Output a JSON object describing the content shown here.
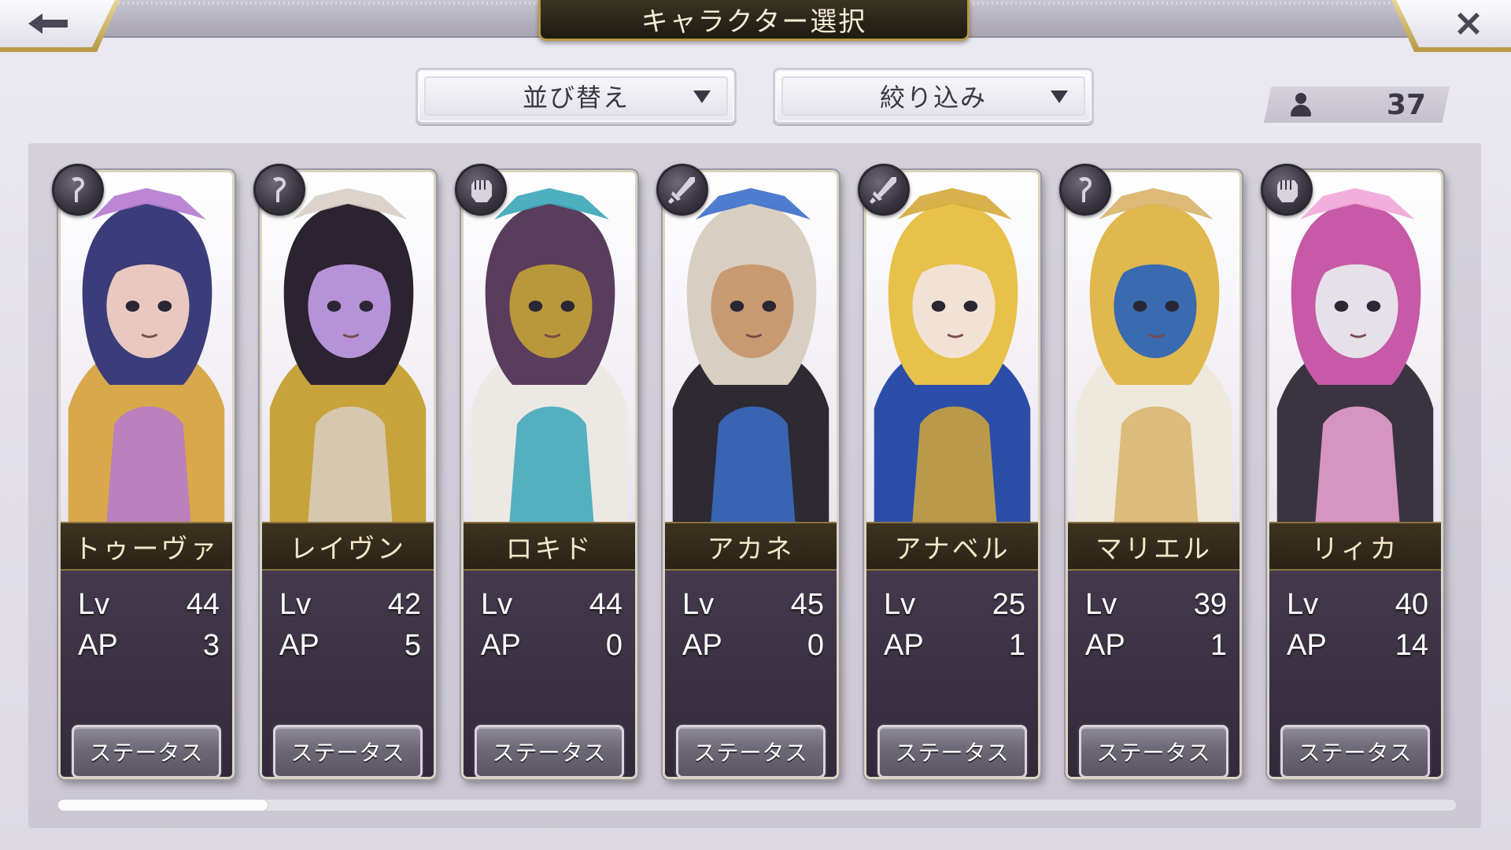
{
  "header": {
    "title": "キャラクター選択",
    "back_icon": "left-arrow-icon",
    "close_icon": "close-icon"
  },
  "controls": {
    "sort_label": "並び替え",
    "filter_label": "絞り込み",
    "count": "37"
  },
  "characters": [
    {
      "name": "トゥーヴァ",
      "lv_label": "Lv",
      "lv": "44",
      "ap_label": "AP",
      "ap": "3",
      "role_icon": "staff-icon",
      "status_label": "ステータス",
      "palette": [
        "#3a3d7a",
        "#d9a84a",
        "#e9c8c0",
        "#b47ad0"
      ]
    },
    {
      "name": "レイヴン",
      "lv_label": "Lv",
      "lv": "42",
      "ap_label": "AP",
      "ap": "5",
      "role_icon": "staff-icon",
      "status_label": "ステータス",
      "palette": [
        "#2b2330",
        "#c8a23a",
        "#b692d8",
        "#d8cfc4"
      ]
    },
    {
      "name": "ロキド",
      "lv_label": "Lv",
      "lv": "44",
      "ap_label": "AP",
      "ap": "0",
      "role_icon": "fist-icon",
      "status_label": "ステータス",
      "palette": [
        "#5a3c5c",
        "#ece8e4",
        "#b8983a",
        "#3aa6b8"
      ]
    },
    {
      "name": "アカネ",
      "lv_label": "Lv",
      "lv": "45",
      "ap_label": "AP",
      "ap": "0",
      "role_icon": "sword-icon",
      "status_label": "ステータス",
      "palette": [
        "#d8cfc2",
        "#2d2a33",
        "#c99a72",
        "#3b6ec9"
      ]
    },
    {
      "name": "アナベル",
      "lv_label": "Lv",
      "lv": "25",
      "ap_label": "AP",
      "ap": "1",
      "role_icon": "sword-icon",
      "status_label": "ステータス",
      "palette": [
        "#e8c14a",
        "#2a4ea8",
        "#f2e2d6",
        "#d4a83a"
      ]
    },
    {
      "name": "マリエル",
      "lv_label": "Lv",
      "lv": "39",
      "ap_label": "AP",
      "ap": "1",
      "role_icon": "staff-icon",
      "status_label": "ステータス",
      "palette": [
        "#e0b84e",
        "#efe8dc",
        "#3a6ab0",
        "#d8b46a"
      ]
    },
    {
      "name": "リィカ",
      "lv_label": "Lv",
      "lv": "40",
      "ap_label": "AP",
      "ap": "14",
      "role_icon": "fist-icon",
      "status_label": "ステータス",
      "palette": [
        "#c65aa6",
        "#3a3440",
        "#e6e0e8",
        "#f2a6d8"
      ]
    }
  ],
  "scrollbar": {
    "position": 0.15
  }
}
